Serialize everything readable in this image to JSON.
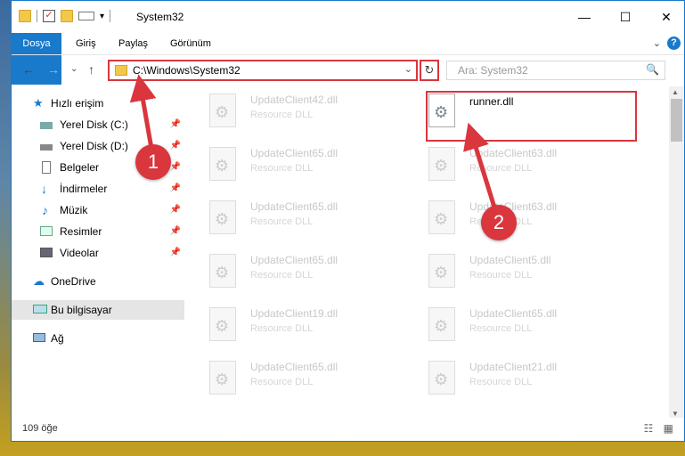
{
  "window": {
    "title": "System32",
    "qat_dropdown": "▾",
    "minimize": "—",
    "maximize": "☐",
    "close": "✕"
  },
  "ribbon": {
    "tabs": [
      "Dosya",
      "Giriş",
      "Paylaş",
      "Görünüm"
    ],
    "collapse_icon": "⌄",
    "help": "?"
  },
  "address": {
    "path": "C:\\Windows\\System32",
    "dropdown": "⌄",
    "refresh": "↻",
    "search_placeholder": "Ara: System32",
    "search_icon": "🔍"
  },
  "nav": {
    "back": "←",
    "forward": "→",
    "recent": "⌄",
    "up": "↑"
  },
  "sidebar": {
    "items": [
      {
        "label": "Hızlı erişim",
        "icon": "star-icon",
        "pinned": false
      },
      {
        "label": "Yerel Disk (C:)",
        "icon": "drive-icon",
        "pinned": true
      },
      {
        "label": "Yerel Disk (D:)",
        "icon": "drive-icon",
        "pinned": true
      },
      {
        "label": "Belgeler",
        "icon": "documents-icon",
        "pinned": true
      },
      {
        "label": "İndirmeler",
        "icon": "download-icon",
        "pinned": true
      },
      {
        "label": "Müzik",
        "icon": "music-icon",
        "pinned": true
      },
      {
        "label": "Resimler",
        "icon": "pictures-icon",
        "pinned": true
      },
      {
        "label": "Videolar",
        "icon": "videos-icon",
        "pinned": true
      },
      {
        "label": "OneDrive",
        "icon": "cloud-icon",
        "pinned": false
      },
      {
        "label": "Bu bilgisayar",
        "icon": "computer-icon",
        "pinned": false
      },
      {
        "label": "Ağ",
        "icon": "network-icon",
        "pinned": false
      }
    ],
    "pin_glyph": "📌"
  },
  "files": {
    "type": "Resource DLL",
    "left": [
      "UpdateClient42.dll",
      "UpdateClient65.dll",
      "UpdateClient65.dll",
      "UpdateClient65.dll",
      "UpdateClient19.dll",
      "UpdateClient65.dll"
    ],
    "right": [
      "runner.dll",
      "UpdateClient63.dll",
      "UpdateClient63.dll",
      "UpdateClient5.dll",
      "UpdateClient65.dll",
      "UpdateClient21.dll"
    ]
  },
  "status": {
    "count": "109 öğe",
    "views": "☷ ▦"
  },
  "annotations": {
    "step1": "1",
    "step2": "2",
    "color": "#d9363e"
  }
}
